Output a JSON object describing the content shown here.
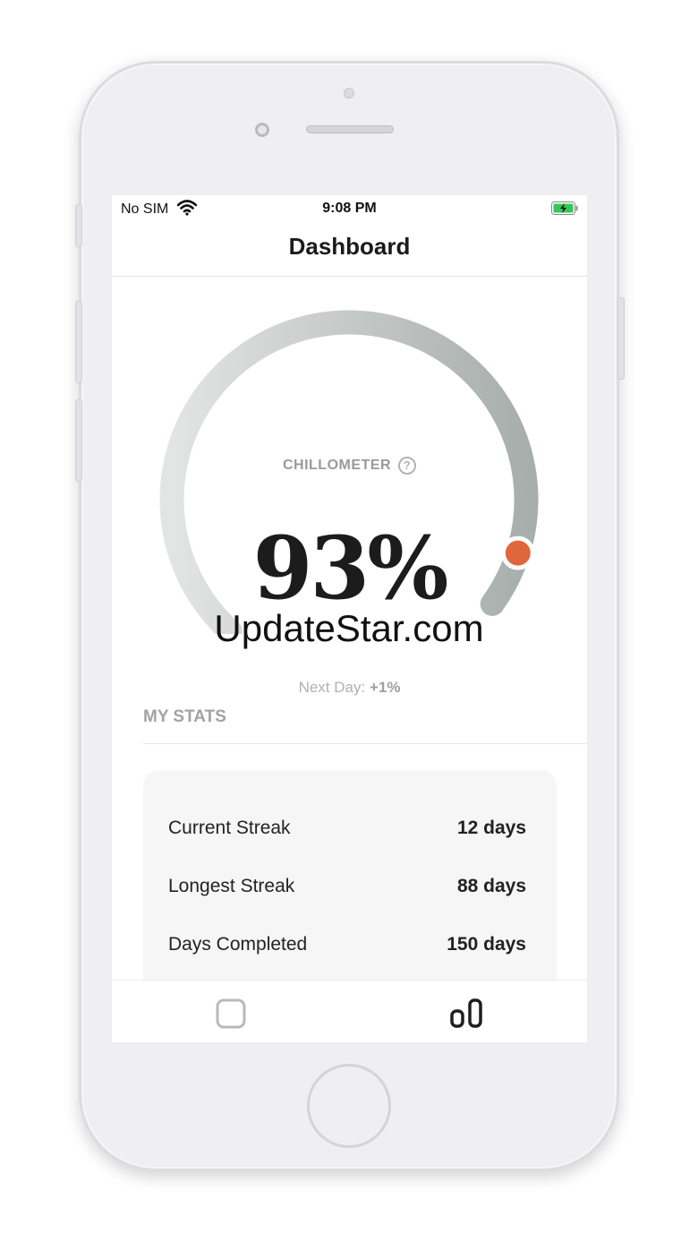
{
  "status": {
    "carrier": "No SIM",
    "time": "9:08 PM",
    "icons": [
      "wifi-icon",
      "battery-charging-icon"
    ]
  },
  "header": {
    "title": "Dashboard"
  },
  "gauge": {
    "label": "CHILLOMETER",
    "help_glyph": "?",
    "value_text": "93%",
    "value": 93,
    "next_day_label": "Next Day:",
    "next_day_value": "+1%",
    "indicator_color": "#e0663c"
  },
  "stats": {
    "title": "MY STATS",
    "rows": [
      {
        "label": "Current Streak",
        "value": "12 days"
      },
      {
        "label": "Longest Streak",
        "value": "88 days"
      },
      {
        "label": "Days Completed",
        "value": "150 days"
      }
    ]
  },
  "tabbar": {
    "tabs": [
      {
        "icon": "square-icon"
      },
      {
        "icon": "stats-icon"
      }
    ]
  },
  "watermark": "UpdateStar.com"
}
